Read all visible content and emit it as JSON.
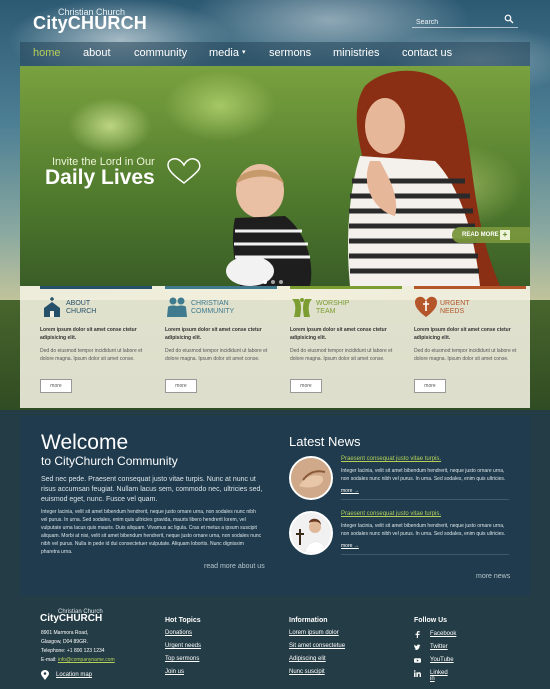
{
  "header": {
    "logo_sub": "Christian Church",
    "logo": "CityCHURCH",
    "search_placeholder": "Search"
  },
  "nav": {
    "items": [
      {
        "label": "home",
        "active": true
      },
      {
        "label": "about"
      },
      {
        "label": "community"
      },
      {
        "label": "media"
      },
      {
        "label": "sermons"
      },
      {
        "label": "ministries"
      },
      {
        "label": "contact us"
      }
    ],
    "media_caret": "▾"
  },
  "slider": {
    "invite": "Invite the Lord in Our",
    "headline": "Daily Lives",
    "read_more": "READ MORE",
    "read_more_plus": "+",
    "slides": 3,
    "active_slide": 1
  },
  "features": [
    {
      "title_line1": "About",
      "title_line2": "Church",
      "color": "#26506a",
      "icon": "church-icon",
      "bold": "Lorem ipsum dolor sit amet conse ctetur adipisicing elit.",
      "text": "Ded do eiusmod tempor incididunt ut labore et dolore magna. Ipsum dolor sit amet conse.",
      "more": "more"
    },
    {
      "title_line1": "Christian",
      "title_line2": "Community",
      "color": "#3f7a8e",
      "icon": "community-icon",
      "bold": "Lorem ipsum dolor sit amet conse ctetur adipisicing elit.",
      "text": "Ded do eiusmod tempor incididunt ut labore et dolore magna. Ipsum dolor sit amet conse.",
      "more": "more"
    },
    {
      "title_line1": "Worship",
      "title_line2": "Team",
      "color": "#7c9d32",
      "icon": "worship-icon",
      "bold": "Lorem ipsum dolor sit amet conse ctetur adipisicing elit.",
      "text": "Ded do eiusmod tempor incididunt ut labore et dolore magna. Ipsum dolor sit amet conse.",
      "more": "more"
    },
    {
      "title_line1": "Urgent",
      "title_line2": "Needs",
      "color": "#b4562a",
      "icon": "heart-cross-icon",
      "bold": "Lorem ipsum dolor sit amet conse ctetur adipisicing elit.",
      "text": "Ded do eiusmod tempor incididunt ut labore et dolore magna. Ipsum dolor sit amet conse.",
      "more": "more"
    }
  ],
  "welcome": {
    "title": "Welcome",
    "subtitle": "to CityChurch Community",
    "lead": "Sed nec pede. Praesent consequat justo vitae turpis. Nunc at nunc ut risus accumsan feugiat. Nullam lacus sem, commodo nec, ultricies sed, euismod eget, nunc. Fusce vel quam.",
    "body": "Integer lacinia, velit sit amet bibendum hendrerit, neque justo ornare urna, non sodales nunc nibh vel purus. In urna. Sed sodales, enim quis ultricies gravida, mauris libero hendrerit lorem, vel vulputate urna lacus quis mauris. Duis aliquam. Vivamus ac ligula. Cras et metus a ipsum suscipit aliquam. Morbi at nisi, velit sit amet bibendum hendrerit, neque justo ornare urna, non sodales nunc nibh vel purus. Nulla in pede id dui consectetuer vulputate. Aliquam lobortis. Nunc dignissim pharetra urna.",
    "read_more": "read more about us"
  },
  "news": {
    "title": "Latest News",
    "items": [
      {
        "title": "Praesent consequat justo vitae turpis.",
        "text": "Integer lacinia, velit sit amet bibendum hendrerit, neque justo ornare urna, non sodales nunc nibh vel purus. In urna. Sed sodales, enim quis ultricies.",
        "more": "more →"
      },
      {
        "title": "Praesent consequat justo vitae turpis.",
        "text": "Integer lacinia, velit sit amet bibendum hendrerit, neque justo ornare urna, non sodales nunc nibh vel purus. In urna. Sed sodales, enim quis ultricies.",
        "more": "more →"
      }
    ],
    "more_news": "more news"
  },
  "footer": {
    "logo_sub": "Christian Church",
    "logo": "CityCHURCH",
    "address_line1": "8901 Marmora Road,",
    "address_line2": "Glasgow, D04 89GR.",
    "telephone": "Telephone: +1 800 123 1234",
    "email_label": "E-mail:",
    "email": "info@companyname.com",
    "location": "Location map",
    "hot_topics": {
      "title": "Hot Topics",
      "links": [
        "Donations",
        "Urgent needs",
        "Top sermons",
        "Join us"
      ]
    },
    "information": {
      "title": "Information",
      "links": [
        "Lorem ipsum dolor",
        "Sit amet consectetue",
        "Adipiscing elit",
        "Nunc suscipit"
      ]
    },
    "follow": {
      "title": "Follow Us",
      "links": [
        "Facebook",
        "Twitter",
        "YouTube",
        "Linked in"
      ]
    }
  }
}
